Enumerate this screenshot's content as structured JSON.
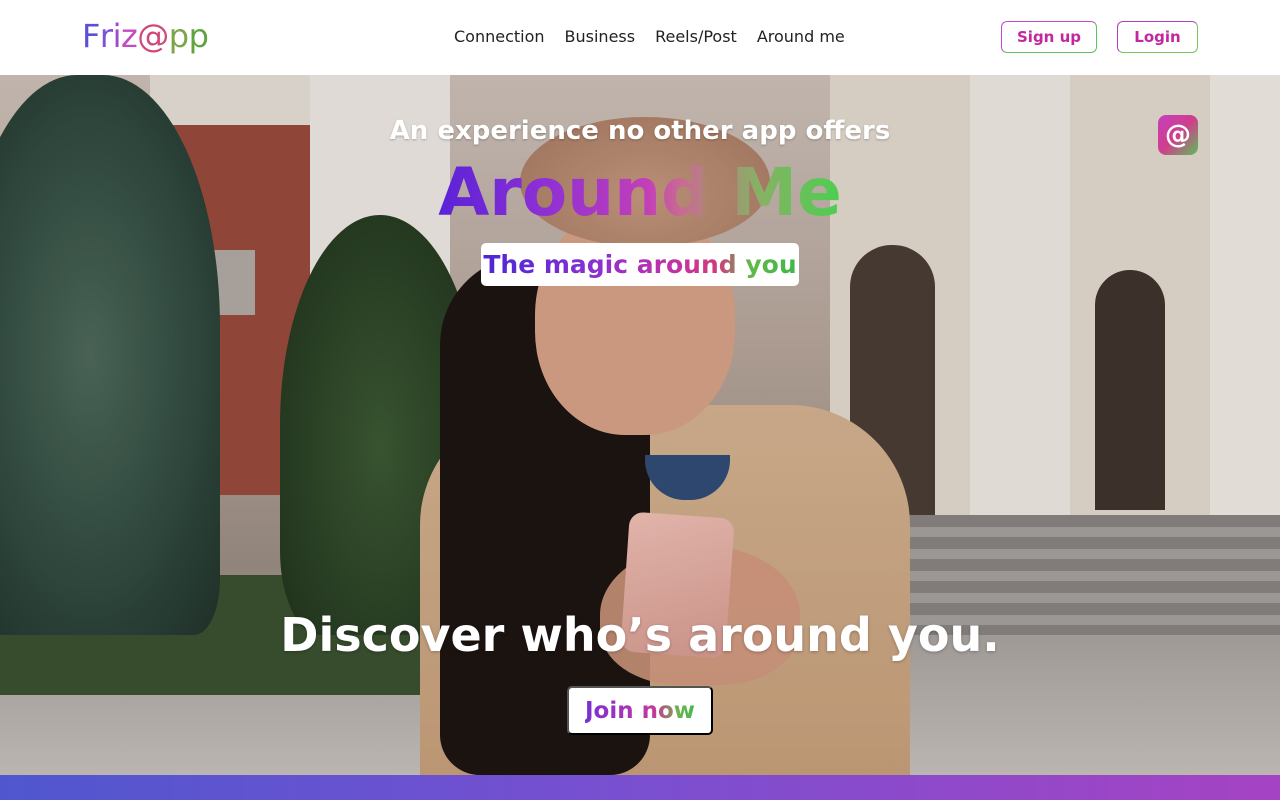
{
  "header": {
    "logo_text": [
      "F",
      "r",
      "i",
      "z",
      "@",
      "p",
      "p"
    ],
    "nav": [
      "Connection",
      "Business",
      "Reels/Post",
      "Around me"
    ],
    "signup_label": "Sign up",
    "login_label": "Login"
  },
  "hero": {
    "tagline": "An experience no other app offers",
    "title": "Around Me",
    "badge": "The magic around you",
    "app_icon_glyph": "@",
    "headline": "Discover who’s around you.",
    "cta_label": "Join now"
  },
  "colors": {
    "brand_purple": "#7a2fd2",
    "brand_magenta": "#c2279f",
    "brand_green": "#4bcf4f",
    "footer_gradient_start": "#4f57cf",
    "footer_gradient_end": "#a543c3"
  },
  "icons": {
    "app_icon": "at-sign-app-icon"
  }
}
